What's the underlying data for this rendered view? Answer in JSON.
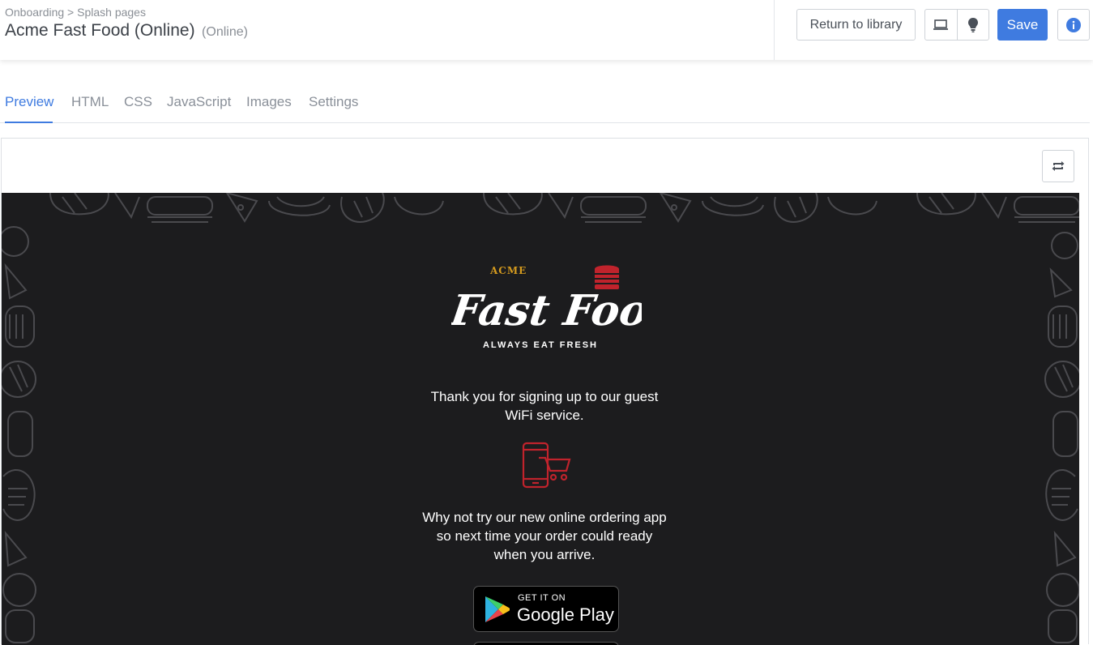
{
  "header": {
    "breadcrumb": "Onboarding > Splash pages",
    "title": "Acme Fast Food (Online)",
    "status": "(Online)",
    "return_label": "Return to library",
    "save_label": "Save"
  },
  "tabs": [
    {
      "label": "Preview",
      "active": true
    },
    {
      "label": "HTML"
    },
    {
      "label": "CSS"
    },
    {
      "label": "JavaScript"
    },
    {
      "label": "Images"
    },
    {
      "label": "Settings"
    }
  ],
  "preview": {
    "logo_brand": "ACME",
    "logo_name": "Fast Food",
    "tagline": "ALWAYS EAT FRESH",
    "message_signup": "Thank you for signing up to our guest WiFi service.",
    "message_app": "Why not try our new online ordering app so next time your order could ready when you arrive.",
    "badge_small": "GET IT ON",
    "badge_big": "Google Play"
  },
  "colors": {
    "accent": "#3f7be0",
    "canvas_bg": "#1c1c1e",
    "brand_red": "#c0232c",
    "brand_gold": "#d49a1e"
  }
}
